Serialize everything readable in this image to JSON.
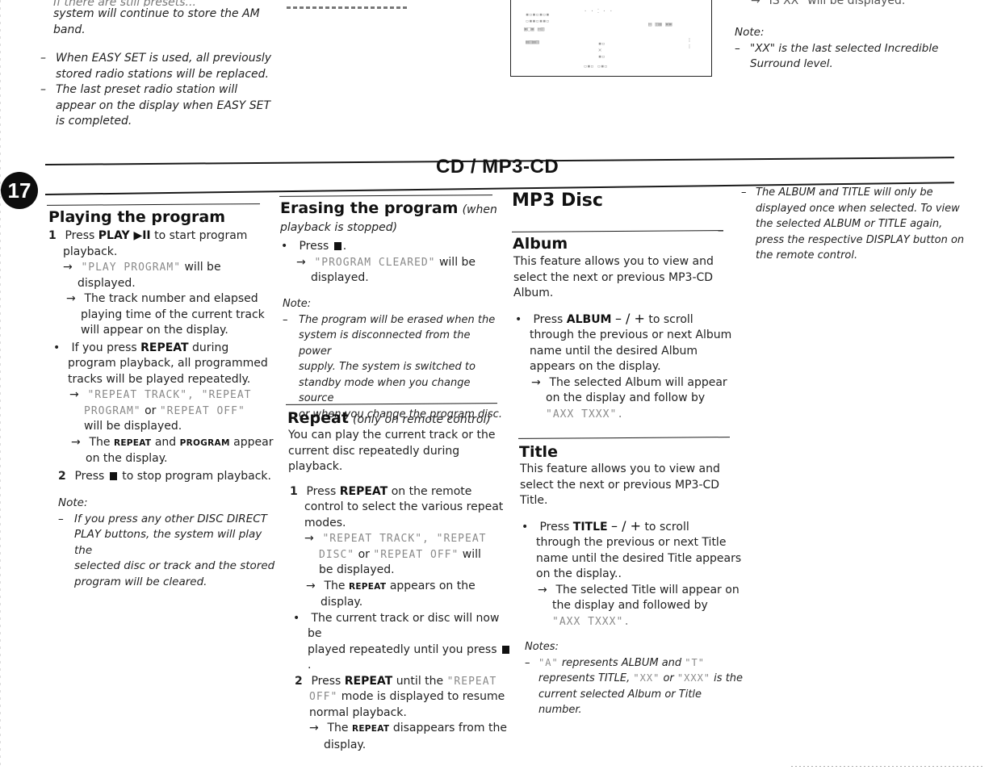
{
  "top_left": {
    "partial_line": "If there are still presets...",
    "line1": "system will continue to store the AM",
    "line2": "band.",
    "items": [
      [
        "When EASY SET is used, all previously",
        "stored radio stations will be replaced."
      ],
      [
        "The last preset radio station will",
        "appear on the display when EASY SET",
        "is completed."
      ]
    ]
  },
  "top_right": {
    "partial_line": "\"IS XX\" will be displayed.",
    "note_label": "Note:",
    "note_line1": "\"XX\" is the last selected Incredible",
    "note_line2": "Surround level.",
    "dash": "–"
  },
  "page": {
    "number": "17",
    "section_title": "CD / MP3-CD"
  },
  "playing": {
    "heading": "Playing the program",
    "step1_num": "1",
    "step1_press": "Press",
    "step1_key": "PLAY ▶II",
    "step1_rest": "to start program",
    "step1_line2": "playback.",
    "r1_lcd": "\"PLAY PROGRAM\"",
    "r1_rest": "will be",
    "r1_line2": "displayed.",
    "r2_l1": "The track number and elapsed",
    "r2_l2": "playing time of the current track",
    "r2_l3": "will appear on the display.",
    "bullet_pre": "If you press",
    "bullet_key": "REPEAT",
    "bullet_post": "during",
    "bullet_l2": "program playback, all programmed",
    "bullet_l3": "tracks will be played repeatedly.",
    "r3_lcd1": "\"REPEAT TRACK\", \"REPEAT",
    "r3_lcd2": "PROGRAM\"",
    "r3_or": "or",
    "r3_lcd3": "\"REPEAT OFF\"",
    "r3_l3": "will be displayed.",
    "r4_pre": "The",
    "r4_k1": "REPEAT",
    "r4_and": "and",
    "r4_k2": "PROGRAM",
    "r4_post": "appear",
    "r4_l2": "on the display.",
    "step2_num": "2",
    "step2_press": "Press",
    "step2_rest": "to stop program playback.",
    "note_label": "Note:",
    "note_lines": [
      "If you press any other DISC DIRECT",
      "PLAY buttons, the system will play the",
      "selected disc or track and the stored",
      "program will be cleared."
    ]
  },
  "erasing": {
    "heading": "Erasing the program",
    "heading_sub": "(when",
    "sub_l2": "playback is stopped)",
    "bullet_press": "Press",
    "r1_lcd": "\"PROGRAM CLEARED\"",
    "r1_rest": "will be",
    "r1_l2": "displayed.",
    "note_label": "Note:",
    "note_lines": [
      "The program will be erased when the",
      "system is disconnected from the power",
      "supply. The system is switched to",
      "standby mode when you change source",
      "or when you change the program disc."
    ]
  },
  "repeat": {
    "heading": "Repeat",
    "heading_sub": "(only on remote control)",
    "intro_l1": "You can play the current track or the",
    "intro_l2": "current disc repeatedly during playback.",
    "step1_num": "1",
    "step1_press": "Press",
    "step1_key": "REPEAT",
    "step1_rest": "on the remote",
    "step1_l2": "control to select the various repeat",
    "step1_l3": "modes.",
    "r1_lcd1": "\"REPEAT TRACK\", \"REPEAT",
    "r1_lcd2": "DISC\"",
    "r1_or": "or",
    "r1_lcd3": "\"REPEAT OFF\"",
    "r1_will": "will",
    "r1_l3": "be displayed.",
    "r2_pre": "The",
    "r2_key": "REPEAT",
    "r2_post": "appears on the",
    "r2_l2": "display.",
    "bullet_l1": "The current track or disc will now be",
    "bullet_l2": "played repeatedly until you press",
    "step2_num": "2",
    "step2_press": "Press",
    "step2_key": "REPEAT",
    "step2_rest": "until the",
    "step2_lcd1": "\"REPEAT",
    "step2_lcd2": "OFF\"",
    "step2_l2_rest": "mode is displayed to resume",
    "step2_l3": "normal playback.",
    "r3_pre": "The",
    "r3_key": "REPEAT",
    "r3_post": "disappears from the",
    "r3_l2": "display."
  },
  "mp3": {
    "heading": "MP3 Disc",
    "album": {
      "heading": "Album",
      "intro": [
        "This feature allows you to view and",
        "select the next or previous MP3-CD",
        "Album."
      ],
      "press": "Press",
      "key": "ALBUM",
      "minus_plus": "– / +",
      "rest": "to scroll",
      "l2": "through the previous or next Album",
      "l3": "name until the desired Album",
      "l4": "appears on the display.",
      "r1_l1": "The selected Album will appear",
      "r1_l2": "on the display and follow by",
      "r1_lcd": "\"AXX TXXX\"."
    },
    "title": {
      "heading": "Title",
      "intro": [
        "This feature allows you to view and",
        "select the next or previous MP3-CD",
        "Title."
      ],
      "press": "Press",
      "key": "TITLE",
      "minus_plus": "– / +",
      "rest": "to scroll",
      "l2": "through the previous or next Title",
      "l3": "name until the desired Title appears",
      "l4": "on the display..",
      "r1_l1": "The selected Title will appear on",
      "r1_l2": "the display and followed by",
      "r1_lcd": "\"AXX TXXX\"."
    },
    "notes_label": "Notes:",
    "notes_a_lcd": "\"A\"",
    "notes_a_text": "represents ALBUM and",
    "notes_t_lcd": "\"T\"",
    "notes_l2_pre": "represents TITLE,",
    "notes_xx": "\"XX\"",
    "notes_or": "or",
    "notes_xxx": "\"XXX\"",
    "notes_l2_post": "is the",
    "notes_l3": "current selected Album or Title number."
  },
  "side_note": {
    "lines": [
      "The ALBUM and TITLE will only be",
      "displayed once when selected. To view",
      "the selected ALBUM or TITLE again,",
      "press the respective DISPLAY button on",
      "the remote control."
    ]
  },
  "symbols": {
    "arrow": "→",
    "bullet": "•",
    "dash": "–"
  }
}
